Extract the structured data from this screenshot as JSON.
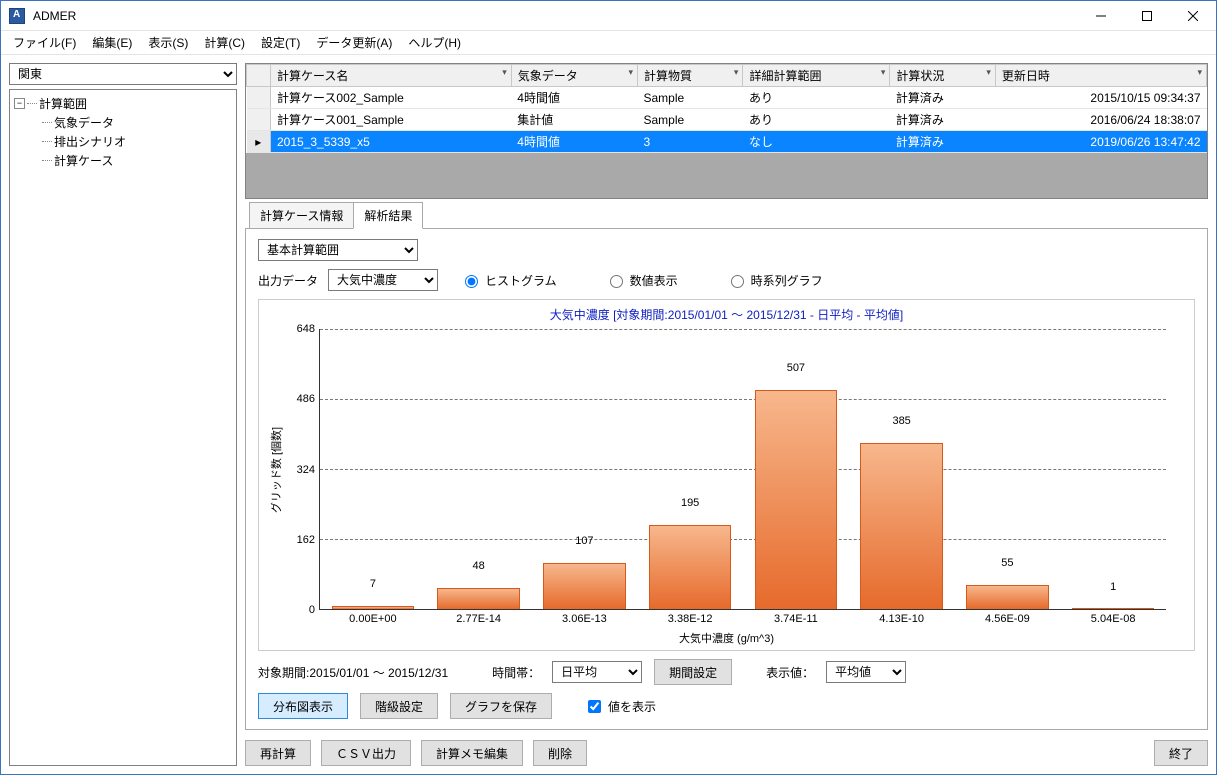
{
  "window": {
    "title": "ADMER"
  },
  "menus": [
    "ファイル(F)",
    "編集(E)",
    "表示(S)",
    "計算(C)",
    "設定(T)",
    "データ更新(A)",
    "ヘルプ(H)"
  ],
  "region_select": "関東",
  "tree": {
    "root": "計算範囲",
    "children": [
      "気象データ",
      "排出シナリオ",
      "計算ケース"
    ]
  },
  "grid": {
    "headers": [
      "計算ケース名",
      "気象データ",
      "計算物質",
      "詳細計算範囲",
      "計算状況",
      "更新日時"
    ],
    "rows": [
      {
        "cells": [
          "計算ケース002_Sample",
          "4時間値",
          "Sample",
          "あり",
          "計算済み",
          "2015/10/15 09:34:37"
        ],
        "selected": false
      },
      {
        "cells": [
          "計算ケース001_Sample",
          "集計値",
          "Sample",
          "あり",
          "計算済み",
          "2016/06/24 18:38:07"
        ],
        "selected": false
      },
      {
        "cells": [
          "2015_3_5339_x5",
          "4時間値",
          "3",
          "なし",
          "計算済み",
          "2019/06/26 13:47:42"
        ],
        "selected": true
      }
    ]
  },
  "tabs": {
    "info": "計算ケース情報",
    "result": "解析結果"
  },
  "analysis": {
    "scope_select": "基本計算範囲",
    "output_label": "出力データ",
    "output_select": "大気中濃度",
    "radios": {
      "histogram": "ヒストグラム",
      "numeric": "数値表示",
      "timeseries": "時系列グラフ"
    },
    "period_label": "対象期間:2015/01/01 ～ 2015/12/31",
    "timeband_label": "時間帯：",
    "timeband_select": "日平均",
    "period_button": "期間設定",
    "dispval_label": "表示値：",
    "dispval_select": "平均値",
    "btn_distribution": "分布図表示",
    "btn_class": "階級設定",
    "btn_savegraph": "グラフを保存",
    "chk_showvalues": "値を表示"
  },
  "footer": {
    "recalc": "再計算",
    "csv": "ＣＳＶ出力",
    "memo": "計算メモ編集",
    "delete": "削除",
    "close": "終了"
  },
  "chart_data": {
    "type": "bar",
    "title": "大気中濃度 [対象期間:2015/01/01 ～ 2015/12/31 - 日平均 - 平均値]",
    "xlabel": "大気中濃度 (g/m^3)",
    "ylabel": "グリッド数 [個数]",
    "ylim": [
      0,
      648
    ],
    "yticks": [
      0,
      162,
      324,
      486,
      648
    ],
    "categories": [
      "0.00E+00",
      "2.77E-14",
      "3.06E-13",
      "3.38E-12",
      "3.74E-11",
      "4.13E-10",
      "4.56E-09",
      "5.04E-08"
    ],
    "values": [
      7,
      48,
      107,
      195,
      507,
      385,
      55,
      1
    ]
  }
}
